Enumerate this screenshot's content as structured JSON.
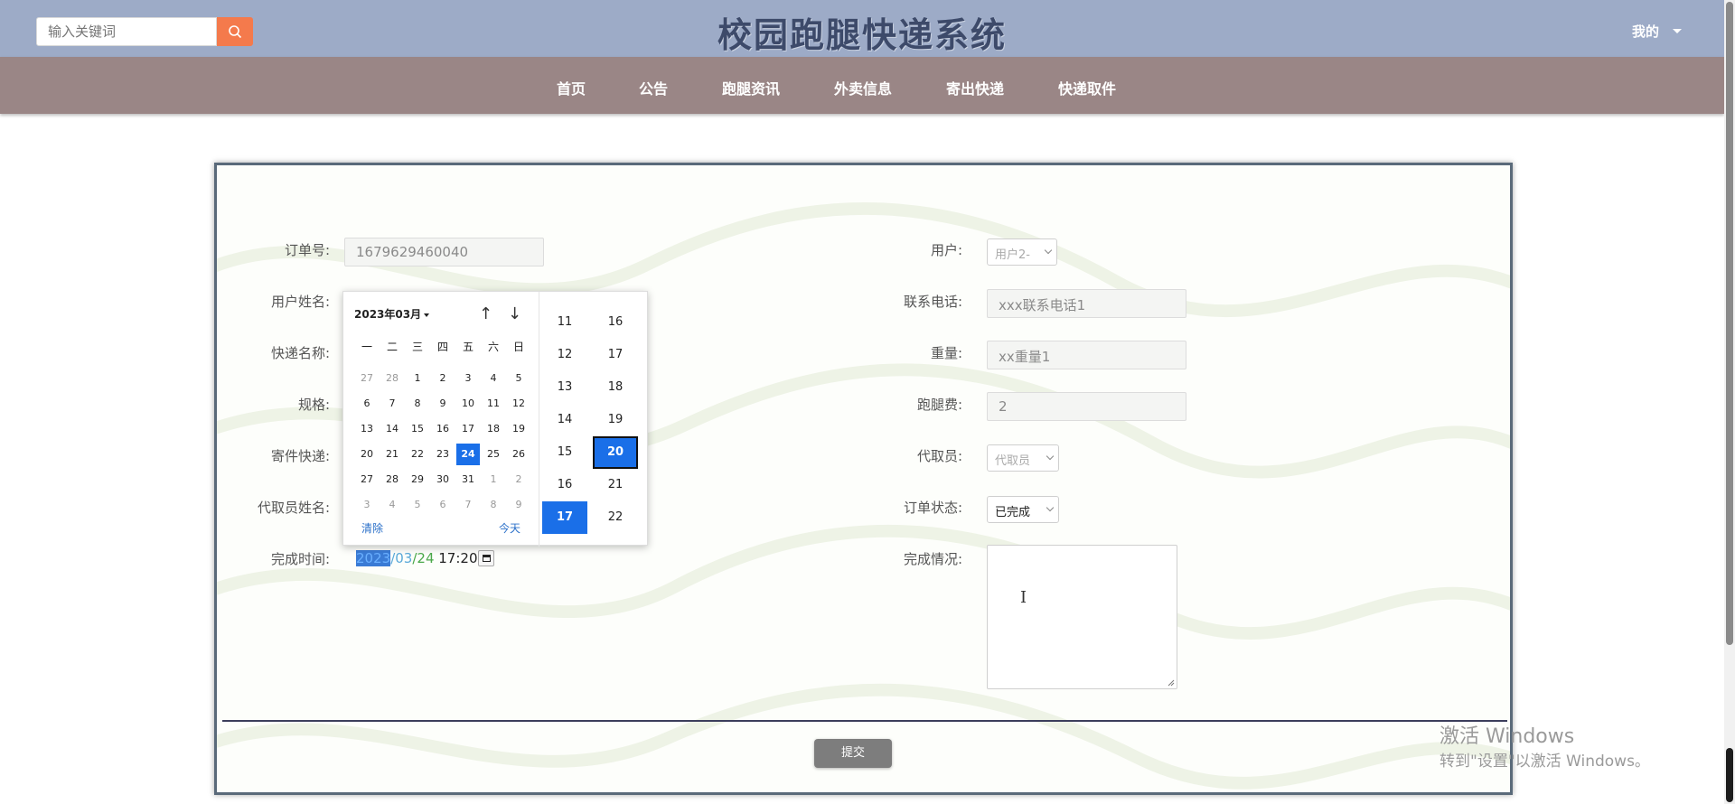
{
  "header": {
    "search_placeholder": "输入关键词",
    "title": "校园跑腿快递系统",
    "user_menu": "我的"
  },
  "nav": {
    "items": [
      "首页",
      "公告",
      "跑腿资讯",
      "外卖信息",
      "寄出快递",
      "快递取件"
    ]
  },
  "form": {
    "left": {
      "order_no_label": "订单号:",
      "order_no_value": "1679629460040",
      "username_label": "用户姓名:",
      "express_name_label": "快递名称:",
      "spec_label": "规格:",
      "send_label": "寄件快递:",
      "agent_name_label": "代取员姓名:",
      "finish_time_label": "完成时间:",
      "finish_time": {
        "year": "2023",
        "sep1": "/",
        "month": "03",
        "sep2": "/",
        "day": "24",
        "time": " 17:20"
      }
    },
    "right": {
      "user_label": "用户:",
      "user_value": "用户2-",
      "phone_label": "联系电话:",
      "phone_value": "xxx联系电话1",
      "weight_label": "重量:",
      "weight_value": "xx重量1",
      "fee_label": "跑腿费:",
      "fee_value": "2",
      "agent_label": "代取员:",
      "agent_value": "代取员",
      "status_label": "订单状态:",
      "status_value": "已完成",
      "result_label": "完成情况:"
    },
    "submit": "提交"
  },
  "datepicker": {
    "month_label": "2023年03月",
    "weekdays": [
      "一",
      "二",
      "三",
      "四",
      "五",
      "六",
      "日"
    ],
    "weeks": [
      [
        "27",
        "28",
        "1",
        "2",
        "3",
        "4",
        "5"
      ],
      [
        "6",
        "7",
        "8",
        "9",
        "10",
        "11",
        "12"
      ],
      [
        "13",
        "14",
        "15",
        "16",
        "17",
        "18",
        "19"
      ],
      [
        "20",
        "21",
        "22",
        "23",
        "24",
        "25",
        "26"
      ],
      [
        "27",
        "28",
        "29",
        "30",
        "31",
        "1",
        "2"
      ],
      [
        "3",
        "4",
        "5",
        "6",
        "7",
        "8",
        "9"
      ]
    ],
    "selected_day": "24",
    "clear": "清除",
    "today": "今天",
    "hours": [
      "11",
      "12",
      "13",
      "14",
      "15",
      "16",
      "17"
    ],
    "minutes": [
      "16",
      "17",
      "18",
      "19",
      "20",
      "21",
      "22"
    ],
    "selected_hour": "17",
    "selected_minute": "20"
  },
  "watermark": {
    "line1": "激活 Windows",
    "line2": "转到\"设置\"以激活 Windows。"
  }
}
